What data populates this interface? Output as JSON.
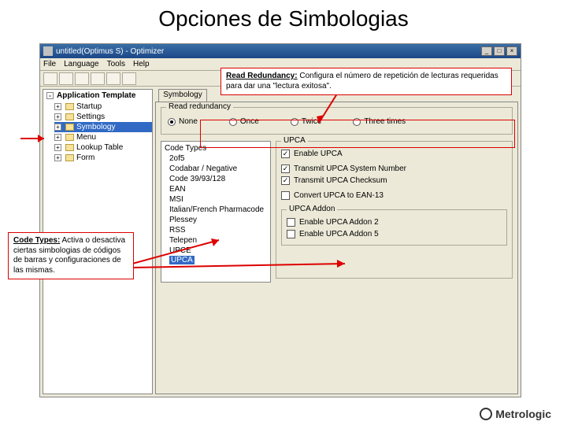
{
  "slide": {
    "title": "Opciones de Simbologias"
  },
  "window": {
    "title": "untitled(Optimus S) - Optimizer",
    "menus": [
      "File",
      "Language",
      "Tools",
      "Help"
    ]
  },
  "tree": {
    "root": "Application Template",
    "items": [
      "Startup",
      "Settings",
      "Symbology",
      "Menu",
      "Lookup Table",
      "Form"
    ],
    "selected": 2
  },
  "tab": {
    "label": "Symbology"
  },
  "redundancy": {
    "group_title": "Read redundancy",
    "options": [
      "None",
      "Once",
      "Twice",
      "Three times"
    ],
    "selected": 0
  },
  "codes": {
    "title": "Code Types",
    "items": [
      "2of5",
      "Codabar / Negative",
      "Code 39/93/128",
      "EAN",
      "MSI",
      "Italian/French Pharmacode",
      "Plessey",
      "RSS",
      "Telepen",
      "UPCE",
      "UPCA"
    ],
    "selected": 10
  },
  "upca": {
    "group_title": "UPCA",
    "enable": {
      "label": "Enable UPCA",
      "checked": true
    },
    "opts": [
      {
        "label": "Transmit UPCA System Number",
        "checked": true
      },
      {
        "label": "Transmit UPCA Checksum",
        "checked": true
      },
      {
        "label": "Convert UPCA to EAN-13",
        "checked": false
      }
    ],
    "addon": {
      "title": "UPCA Addon",
      "opts": [
        {
          "label": "Enable UPCA Addon 2",
          "checked": false
        },
        {
          "label": "Enable UPCA Addon 5",
          "checked": false
        }
      ]
    }
  },
  "callouts": {
    "read": {
      "title": "Read Redundancy:",
      "text": " Configura el número de repetición de lecturas requeridas para dar una \"lectura exitosa\"."
    },
    "codes": {
      "title": "Code Types:",
      "text": " Activa o desactiva ciertas simbologias de códigos de barras y configuraciones de las mismas."
    }
  },
  "brand": "Metrologic"
}
